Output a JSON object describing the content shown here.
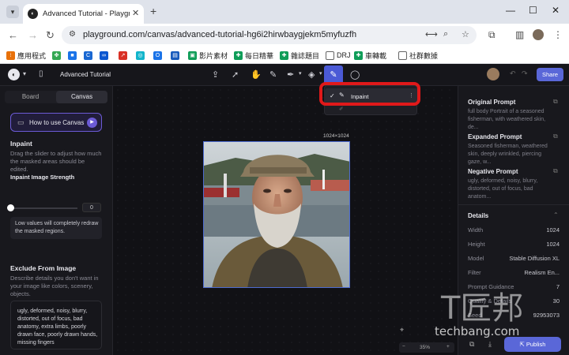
{
  "browser": {
    "tab_title": "Advanced Tutorial - Playgrou",
    "url": "playground.com/canvas/advanced-tutorial-hg6i2hirwbaygjekm5myfuzfh",
    "bookmarks": [
      "應用程式",
      "影片素材",
      "每日精華",
      "雜誌題目",
      "DRJ",
      "車轉載",
      "社群數據"
    ]
  },
  "app": {
    "title": "Advanced Tutorial",
    "share_label": "Share",
    "left": {
      "tabs": [
        "Board",
        "Canvas"
      ],
      "how_to": "How to use Canvas",
      "section_title": "Inpaint",
      "section_desc": "Drag the slider to adjust how much the masked areas should be edited.",
      "strength_label": "Inpaint Image Strength",
      "strength_value": "0",
      "strength_fraction": 0,
      "info_text": "Low values will completely redraw the masked regions.",
      "exclude_title": "Exclude From Image",
      "exclude_desc": "Describe details you don't want in your image like colors, scenery, objects.",
      "negative_text": "ugly, deformed, noisy, blurry, distorted, out of focus, bad anatomy, extra limbs, poorly drawn face, poorly drawn hands, missing fingers"
    },
    "canvas": {
      "dims": "1024×1024",
      "zoom": "35%",
      "dropdown": {
        "item": "Inpaint"
      }
    },
    "right": {
      "original_title": "Original Prompt",
      "original_text": "full body Portrait of a seasoned fisherman, with weathered skin, de...",
      "expanded_title": "Expanded Prompt",
      "expanded_text": "Seasoned fisherman, weathered skin, deeply wrinkled, piercing gaze, w...",
      "negative_title": "Negative Prompt",
      "negative_text": "ugly, deformed, noisy, blurry, distorted, out of focus, bad anatom...",
      "details_title": "Details",
      "details": [
        {
          "label": "Width",
          "value": "1024"
        },
        {
          "label": "Height",
          "value": "1024"
        },
        {
          "label": "Model",
          "value": "Stable Diffusion XL"
        },
        {
          "label": "Filter",
          "value": "Realism En..."
        },
        {
          "label": "Prompt Guidance",
          "value": "7"
        },
        {
          "label": "Quality & Details",
          "value": "30"
        },
        {
          "label": "Seed",
          "value": "92953073"
        }
      ],
      "publish_label": "Publish"
    }
  },
  "watermark": {
    "text": "techbang.com"
  }
}
